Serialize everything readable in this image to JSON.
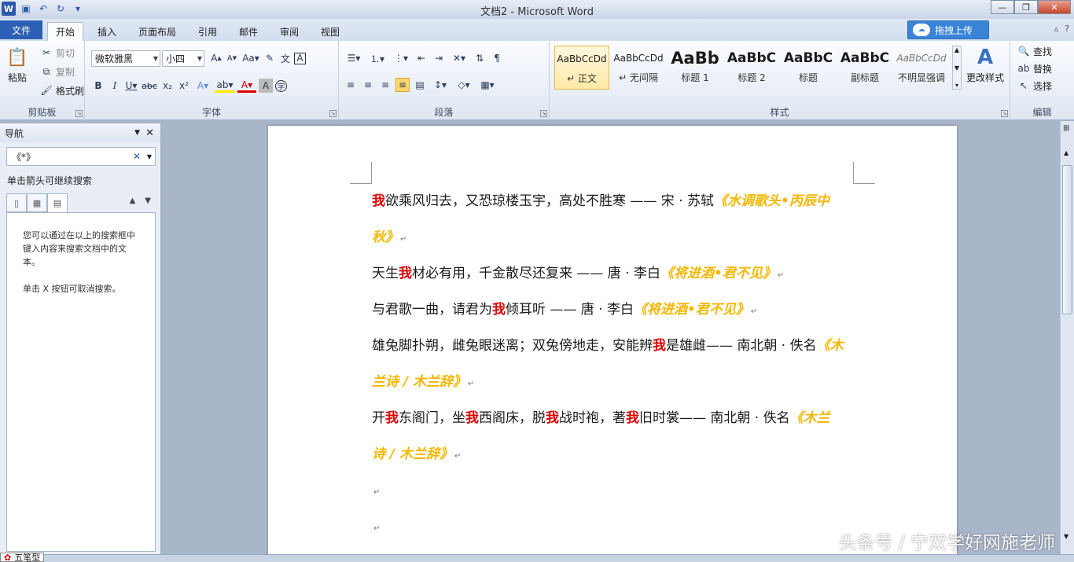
{
  "window": {
    "title": "文档2 - Microsoft Word"
  },
  "tabs": {
    "file": "文件",
    "home": "开始",
    "insert": "插入",
    "layout": "页面布局",
    "references": "引用",
    "mailings": "邮件",
    "review": "审阅",
    "view": "视图"
  },
  "upload": {
    "label": "拖拽上传"
  },
  "clipboard": {
    "paste": "粘贴",
    "cut": "剪切",
    "copy": "复制",
    "format_painter": "格式刷",
    "group": "剪贴板"
  },
  "font": {
    "name": "微软雅黑",
    "size": "小四",
    "group": "字体"
  },
  "paragraph": {
    "group": "段落"
  },
  "styles": {
    "group": "样式",
    "items": [
      {
        "sample": "AaBbCcDd",
        "name": "↵ 正文"
      },
      {
        "sample": "AaBbCcDd",
        "name": "↵ 无间隔"
      },
      {
        "sample": "AaBb",
        "name": "标题 1"
      },
      {
        "sample": "AaBbC",
        "name": "标题 2"
      },
      {
        "sample": "AaBbC",
        "name": "标题"
      },
      {
        "sample": "AaBbC",
        "name": "副标题"
      },
      {
        "sample": "AaBbCcDd",
        "name": "不明显强调"
      }
    ],
    "change": "更改样式"
  },
  "editing": {
    "find": "查找",
    "replace": "替换",
    "select": "选择",
    "group": "编辑"
  },
  "nav": {
    "title": "导航",
    "search_value": "《*》",
    "hint": "单击箭头可继续搜索",
    "body1": "您可以通过在以上的搜索框中键入内容来搜索文档中的文本。",
    "body2": "单击 X 按钮可取消搜索。"
  },
  "doc": {
    "l1a": "我",
    "l1b": "欲乘风归去，又恐琼楼玉宇，高处不胜寒 —— 宋 · 苏轼",
    "l1c": "《水调歌头•丙辰中",
    "l2": "秋》",
    "l3a": "天生",
    "l3b": "我",
    "l3c": "材必有用，千金散尽还复来 —— 唐 · 李白",
    "l3d": "《将进酒•君不见》",
    "l4a": "与君歌一曲，请君为",
    "l4b": "我",
    "l4c": "倾耳听 —— 唐 · 李白",
    "l4d": "《将进酒•君不见》",
    "l5a": "雄兔脚扑朔，雌兔眼迷离；双兔傍地走，安能辨",
    "l5b": "我",
    "l5c": "是雄雌—— 南北朝 · 佚名",
    "l5d": "《木",
    "l6": "兰诗 / 木兰辞》",
    "l7a": "开",
    "l7b": "我",
    "l7c": "东阁门，坐",
    "l7d": "我",
    "l7e": "西阁床，脱",
    "l7f": "我",
    "l7g": "战时袍，著",
    "l7h": "我",
    "l7i": "旧时裳—— 南北朝 · 佚名",
    "l7j": "《木兰",
    "l8": "诗 / 木兰辞》",
    "pmark": "↵"
  },
  "watermark": "头条号 / 宁双学好网施老师",
  "ime": {
    "label": "五笔型"
  }
}
